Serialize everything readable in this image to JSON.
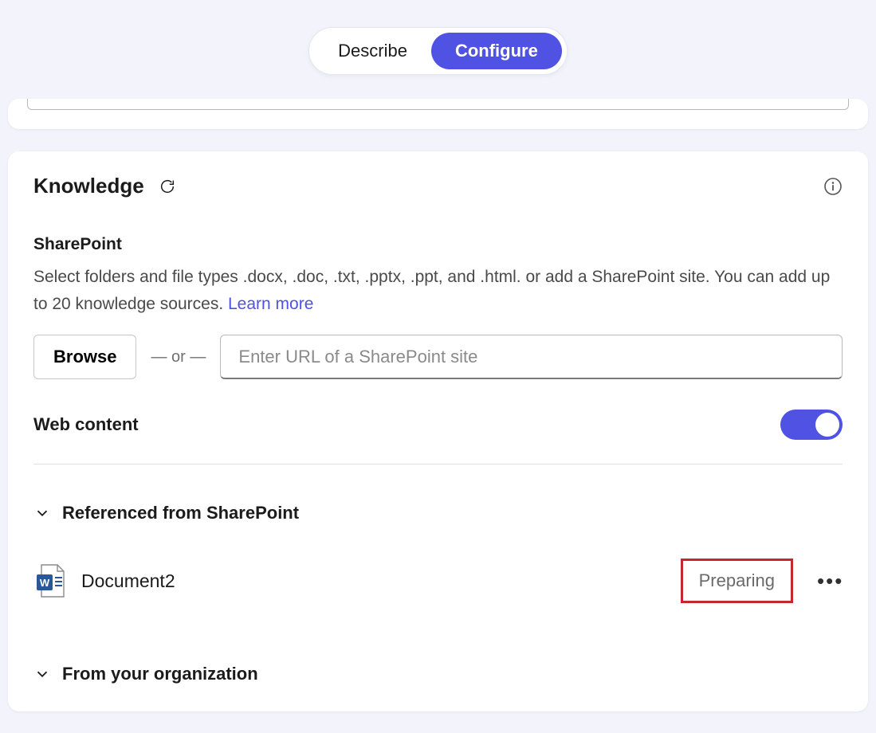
{
  "top_toggle": {
    "describe": "Describe",
    "configure": "Configure"
  },
  "knowledge": {
    "title": "Knowledge",
    "sharepoint_label": "SharePoint",
    "sharepoint_desc_1": "Select folders and file types .docx, .doc, .txt, .pptx, .ppt, and .html. or add a SharePoint site. You can add up to 20 knowledge sources. ",
    "learn_more": "Learn more",
    "browse": "Browse",
    "or": "— or —",
    "url_placeholder": "Enter URL of a SharePoint site",
    "web_content_label": "Web content",
    "web_content_on": true,
    "referenced_label": "Referenced from SharePoint",
    "from_org_label": "From your organization",
    "doc": {
      "name": "Document2",
      "status": "Preparing"
    }
  }
}
